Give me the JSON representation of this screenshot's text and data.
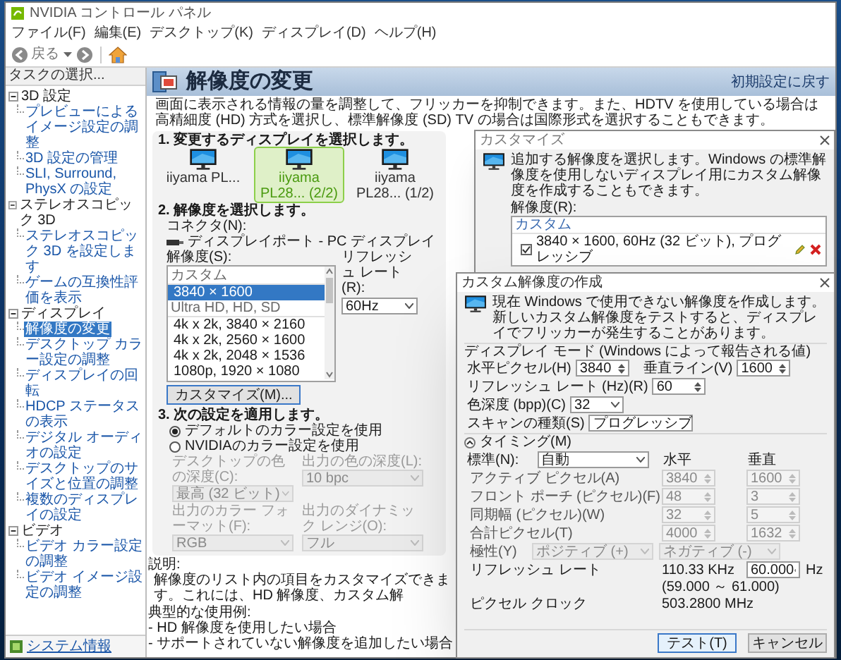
{
  "window": {
    "title": "NVIDIA コントロール パネル",
    "menu": [
      "ファイル(F)",
      "編集(E)",
      "デスクトップ(K)",
      "ディスプレイ(D)",
      "ヘルプ(H)"
    ],
    "back_label": "戻る"
  },
  "sidebar": {
    "header": "タスクの選択...",
    "tree": [
      {
        "label": "3D 設定",
        "expanded": true,
        "children": [
          {
            "label": "プレビューによるイメージ設定の調整",
            "selected": false
          },
          {
            "label": "3D 設定の管理",
            "selected": false
          },
          {
            "label": "SLI, Surround, PhysX の設定",
            "selected": false
          }
        ]
      },
      {
        "label": "ステレオスコピック 3D",
        "expanded": true,
        "children": [
          {
            "label": "ステレオスコピック 3D を設定します",
            "selected": false
          },
          {
            "label": "ゲームの互換性評価を表示",
            "selected": false
          }
        ]
      },
      {
        "label": "ディスプレイ",
        "expanded": true,
        "children": [
          {
            "label": "解像度の変更",
            "selected": true
          },
          {
            "label": "デスクトップ カラー設定の調整",
            "selected": false
          },
          {
            "label": "ディスプレイの回転",
            "selected": false
          },
          {
            "label": "HDCP ステータスの表示",
            "selected": false
          },
          {
            "label": "デジタル オーディオの設定",
            "selected": false
          },
          {
            "label": "デスクトップのサイズと位置の調整",
            "selected": false
          },
          {
            "label": "複数のディスプレイの設定",
            "selected": false
          }
        ]
      },
      {
        "label": "ビデオ",
        "expanded": true,
        "children": [
          {
            "label": "ビデオ カラー設定の調整",
            "selected": false
          },
          {
            "label": "ビデオ イメージ設定の調整",
            "selected": false
          }
        ]
      }
    ],
    "footer_link": "システム情報"
  },
  "page": {
    "title": "解像度の変更",
    "restore_link": "初期設定に戻す",
    "description": "画面に表示される情報の量を調整して、フリッカーを抑制できます。また、HDTV を使用している場合は高精細度 (HD) 方式を選択し、標準解像度 (SD) TV の場合は国際形式を選択することもできます。",
    "step1": {
      "heading": "1. 変更するディスプレイを選択します。",
      "displays": [
        {
          "label": "iiyama PL...",
          "selected": false
        },
        {
          "label": "iiyama PL28... (2/2)",
          "selected": true
        },
        {
          "label": "iiyama PL28... (1/2)",
          "selected": false
        }
      ]
    },
    "step2": {
      "heading": "2. 解像度を選択します。",
      "connector_label": "コネクタ(N):",
      "connector": "ディスプレイポート - PC ディスプレイ",
      "resolution_label": "解像度(S):",
      "resolutions": [
        {
          "kind": "group",
          "label": "カスタム"
        },
        {
          "kind": "item",
          "label": "3840 × 1600",
          "selected": true
        },
        {
          "kind": "group",
          "label": "Ultra HD, HD, SD"
        },
        {
          "kind": "item",
          "label": "4k x 2k, 3840 × 2160",
          "selected": false
        },
        {
          "kind": "item",
          "label": "4k x 2k, 2560 × 1600",
          "selected": false
        },
        {
          "kind": "item",
          "label": "4k x 2k, 2048 × 1536",
          "selected": false
        },
        {
          "kind": "item",
          "label": "1080p, 1920 × 1080",
          "selected": false
        }
      ],
      "refresh_label": "リフレッシュ レート(R):",
      "refresh": "60Hz",
      "customize_button": "カスタマイズ(M)..."
    },
    "step3": {
      "heading": "3. 次の設定を適用します。",
      "options": [
        {
          "label": "デフォルトのカラー設定を使用",
          "selected": true
        },
        {
          "label": "NVIDIAのカラー設定を使用",
          "selected": false
        }
      ],
      "fields": [
        {
          "label": "デスクトップの色の深度(C):",
          "value": "最高 (32 ビット)",
          "disabled": true
        },
        {
          "label": "出力の色の深度(L):",
          "value": "10 bpc",
          "disabled": true
        },
        {
          "label": "出力のカラー フォーマット(F):",
          "value": "RGB",
          "disabled": true
        },
        {
          "label": "出力のダイナミック レンジ(O):",
          "value": "フル",
          "disabled": true
        }
      ]
    },
    "explanation": {
      "label": "説明:",
      "text": "解像度のリスト内の項目をカスタマイズできます。これには、HD 解像度、カスタム解"
    },
    "usage": {
      "label": "典型的な使用例:",
      "items": [
        "- HD 解像度を使用したい場合",
        "- サポートされていない解像度を追加したい場合"
      ]
    }
  },
  "customize_dialog": {
    "title": "カスタマイズ",
    "intro": "追加する解像度を選択します。Windows の標準解像度を使用しないディスプレイ用にカスタム解像度を作成することもできます。",
    "list_label": "解像度(R):",
    "group": "カスタム",
    "items": [
      {
        "label": "3840 × 1600, 60Hz (32 ビット), プログレッシブ",
        "checked": true
      }
    ]
  },
  "create_dialog": {
    "title": "カスタム解像度の作成",
    "intro": "現在 Windows で使用できない解像度を作成します。新しいカスタム解像度をテストすると、ディスプレイでフリッカーが発生することがあります。",
    "mode_label": "ディスプレイ モード (Windows によって報告される値)",
    "mode_fields": [
      {
        "kind": "spin",
        "label": "水平ピクセル(H)",
        "value": "3840"
      },
      {
        "kind": "spin",
        "label": "垂直ライン(V)",
        "value": "1600"
      },
      {
        "kind": "spin",
        "label": "リフレッシュ レート (Hz)(R)",
        "value": "60"
      },
      {
        "kind": "select",
        "label": "色深度 (bpp)(C)",
        "value": "32"
      },
      {
        "kind": "select",
        "label": "スキャンの種類(S)",
        "value": "プログレッシブ"
      }
    ],
    "timing": {
      "label": "タイミング(M)",
      "expanded": true,
      "standard_label": "標準(N):",
      "standard": "自動",
      "columns": [
        "水平",
        "垂直"
      ],
      "rows": [
        {
          "kind": "spin",
          "label": "アクティブ ピクセル(A)",
          "values": [
            "3840",
            "1600"
          ],
          "disabled": true
        },
        {
          "kind": "spin",
          "label": "フロント ポーチ (ピクセル)(F)",
          "values": [
            "48",
            "3"
          ],
          "disabled": true
        },
        {
          "kind": "spin",
          "label": "同期幅 (ピクセル)(W)",
          "values": [
            "32",
            "5"
          ],
          "disabled": true
        },
        {
          "kind": "spin",
          "label": "合計ピクセル(T)",
          "values": [
            "4000",
            "1632"
          ],
          "disabled": true
        },
        {
          "kind": "select",
          "label": "極性(Y)",
          "values": [
            "ポジティブ (+)",
            "ネガティブ (-)"
          ],
          "disabled": true
        }
      ],
      "refresh_label": "リフレッシュ レート",
      "refresh_h": "110.33 KHz",
      "refresh_v": "60.000",
      "refresh_unit": "Hz",
      "range": "(59.000 ～ 61.000)",
      "clock_label": "ピクセル クロック",
      "clock": "503.2800 MHz"
    },
    "buttons": [
      "テスト(T)",
      "キャンセル"
    ]
  }
}
